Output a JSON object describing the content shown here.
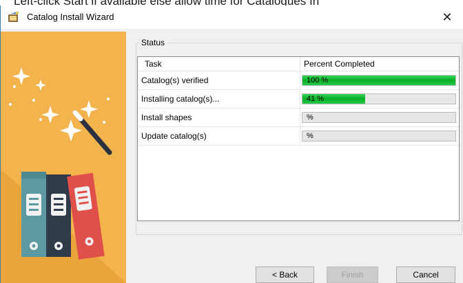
{
  "background_text": "Left-click Start if available else allow time for Catalogues In",
  "window": {
    "title": "Catalog Install Wizard",
    "close_glyph": "✕"
  },
  "status": {
    "group_label": "Status",
    "columns": [
      "Task",
      "Percent Completed"
    ],
    "rows": [
      {
        "task": "Catalog(s) verified",
        "percent": 100,
        "percent_text": "100 %"
      },
      {
        "task": "Installing catalog(s)...",
        "percent": 41,
        "percent_text": "41 %"
      },
      {
        "task": "Install shapes",
        "percent": 0,
        "percent_text": "%"
      },
      {
        "task": "Update catalog(s)",
        "percent": 0,
        "percent_text": "%"
      }
    ]
  },
  "buttons": {
    "back": "< Back",
    "finish": "Finish",
    "cancel": "Cancel"
  },
  "colors": {
    "banner": "#f3b34d",
    "progress": "#06b025",
    "window_border": "#3c7fb1"
  },
  "icons": [
    "wizard-app-icon",
    "close-icon",
    "magic-wand-icon",
    "sparkle-icon",
    "binder-icon"
  ]
}
